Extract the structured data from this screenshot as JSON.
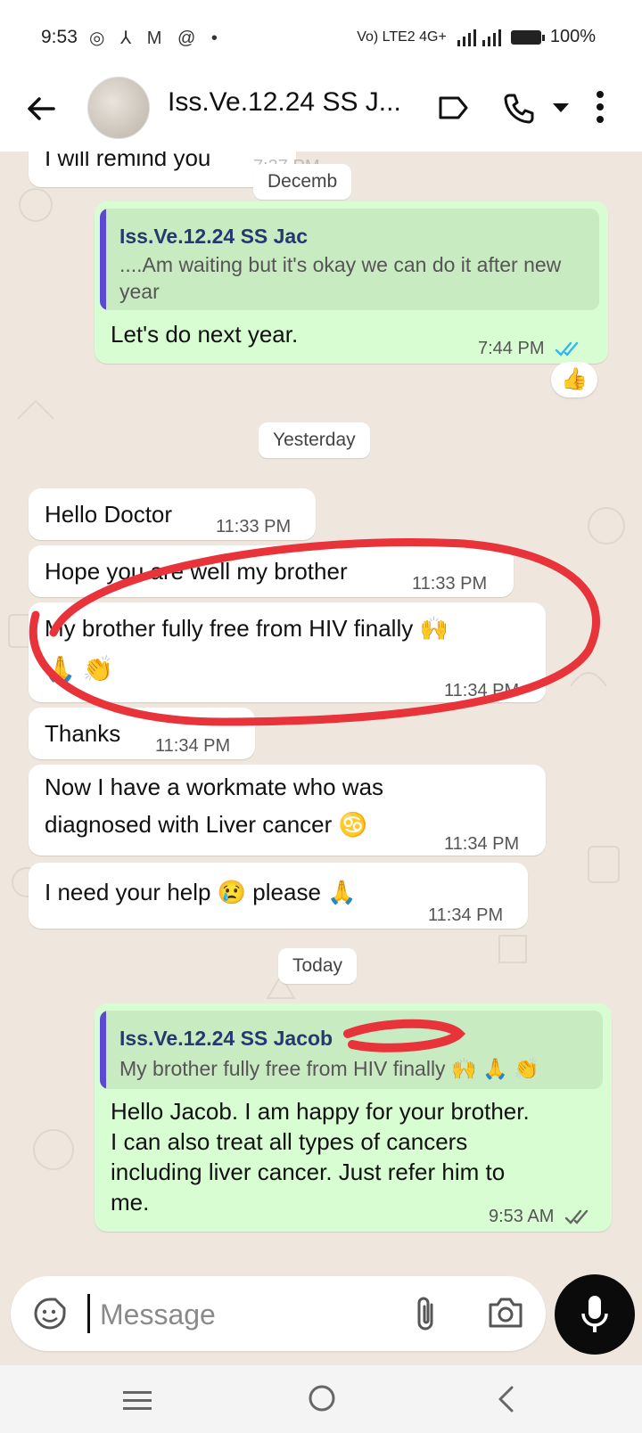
{
  "status_bar": {
    "time": "9:53",
    "icons_left": "◎ ⅄ M @ •",
    "signal_text": "Vo) LTE2 4G+",
    "battery": "100%"
  },
  "header": {
    "title": "Iss.Ve.12.24 SS J..."
  },
  "messages": {
    "m0": {
      "text": "I will remind you",
      "time": "7:37 PM"
    },
    "chip_partial": "Decemb",
    "m1": {
      "quote_name": "Iss.Ve.12.24 SS Jac",
      "quote_text": "....Am waiting but it's okay we can do it after new year",
      "text": "Let's do next year.",
      "time": "7:44 PM",
      "reaction": "👍"
    },
    "day_yesterday": "Yesterday",
    "m2": {
      "text": "Hello Doctor",
      "time": "11:33 PM"
    },
    "m3": {
      "text": "Hope you are well my brother",
      "time": "11:33 PM"
    },
    "m4": {
      "line1": "My brother fully free from HIV finally 🙌",
      "line2": "🙏 👏",
      "time": "11:34 PM"
    },
    "m5": {
      "text": "Thanks",
      "time": "11:34 PM"
    },
    "m6": {
      "line1": "Now I have a workmate who was",
      "line2": "diagnosed with Liver cancer ♋",
      "time": "11:34 PM"
    },
    "m7": {
      "text": "I need your help 😢 please 🙏",
      "time": "11:34 PM"
    },
    "day_today": "Today",
    "m8": {
      "quote_name": "Iss.Ve.12.24 SS Jacob",
      "quote_text": "My brother fully free from HIV finally 🙌 🙏 👏",
      "line1": "Hello Jacob. I am happy for your brother.",
      "line2": "I can also treat all types of cancers",
      "line3": "including liver cancer. Just refer him to",
      "line4": "me.",
      "time": "9:53 AM"
    }
  },
  "input": {
    "placeholder": "Message"
  },
  "colors": {
    "outgoing_bubble": "#d9fdd3",
    "incoming_bubble": "#ffffff",
    "wallpaper": "#efe7de",
    "read_tick": "#34b7f1",
    "annotation_red": "#e8333a"
  }
}
